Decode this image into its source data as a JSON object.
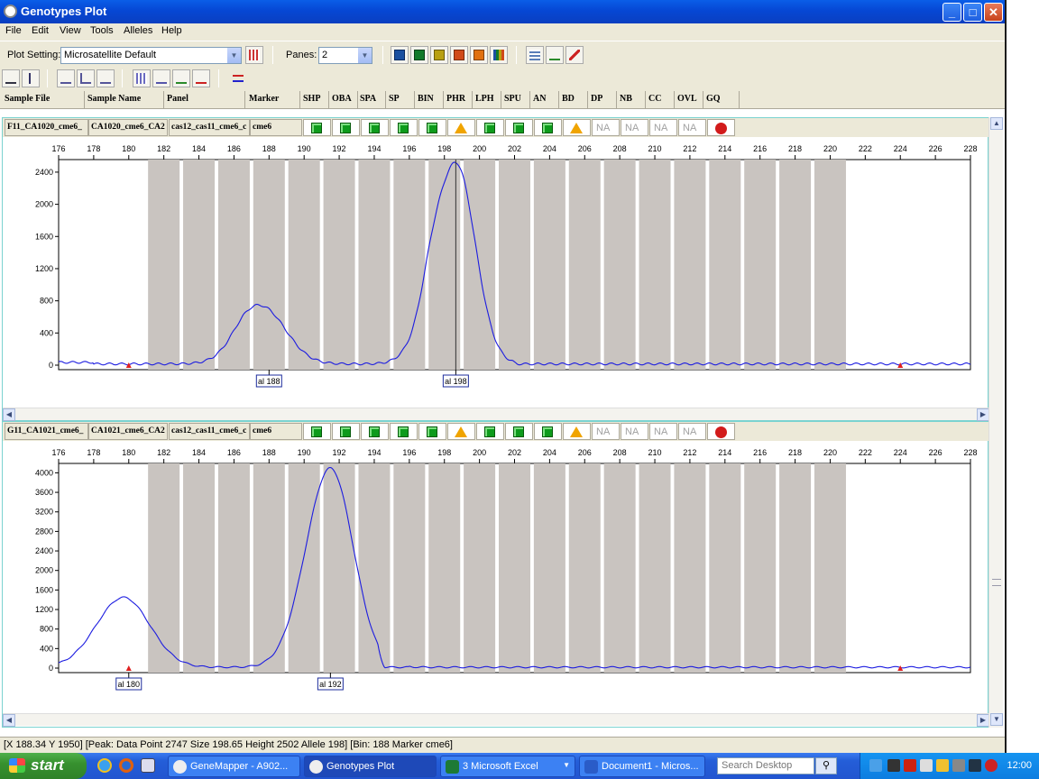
{
  "window": {
    "title": "Genotypes Plot"
  },
  "menu": [
    "File",
    "Edit",
    "View",
    "Tools",
    "Alleles",
    "Help"
  ],
  "toolbar": {
    "plot_setting_label": "Plot Setting:",
    "plot_setting_value": "Microsatellite Default",
    "panes_label": "Panes:",
    "panes_value": "2"
  },
  "columns": [
    "Sample File",
    "Sample Name",
    "Panel",
    "Marker",
    "SHP",
    "OBA",
    "SPA",
    "SP",
    "BIN",
    "PHR",
    "LPH",
    "SPU",
    "AN",
    "BD",
    "DP",
    "NB",
    "CC",
    "OVL",
    "GQ"
  ],
  "x_ticks": [
    176,
    178,
    180,
    182,
    184,
    186,
    188,
    190,
    192,
    194,
    196,
    198,
    200,
    202,
    204,
    206,
    208,
    210,
    212,
    214,
    216,
    218,
    220,
    222,
    224,
    226,
    228
  ],
  "flag_types": [
    "green",
    "green",
    "green",
    "green",
    "green",
    "yellow",
    "green",
    "green",
    "green",
    "yellow",
    "na",
    "na",
    "na",
    "na",
    "red"
  ],
  "na_label": "NA",
  "panes": [
    {
      "sample_file": "F11_CA1020_cme6_",
      "sample_name": "CA1020_cme6_CA2",
      "panel": "cas12_cas11_cme6_c",
      "marker": "cme6",
      "y_ticks": [
        0,
        400,
        800,
        1200,
        1600,
        2000,
        2400
      ],
      "y_max": 2500,
      "alleles": [
        {
          "label": "al 188",
          "x": 188
        },
        {
          "label": "al 198",
          "x": 198.65
        }
      ]
    },
    {
      "sample_file": "G11_CA1021_cme6_",
      "sample_name": "CA1021_cme6_CA2",
      "panel": "cas12_cas11_cme6_c",
      "marker": "cme6",
      "y_ticks": [
        0,
        400,
        800,
        1200,
        1600,
        2000,
        2400,
        2800,
        3200,
        3600,
        4000
      ],
      "y_max": 4100,
      "alleles": [
        {
          "label": "al 180",
          "x": 180
        },
        {
          "label": "al 192",
          "x": 191.5
        }
      ]
    }
  ],
  "status": "[X 188.34  Y 1950]  [Peak: Data Point 2747  Size 198.65  Height 2502  Allele 198]  [Bin: 188 Marker cme6]",
  "taskbar": {
    "start": "start",
    "tasks": [
      "GeneMapper - A902...",
      "Genotypes Plot",
      "3 Microsoft Excel",
      "Document1 - Micros..."
    ],
    "search_placeholder": "Search Desktop",
    "clock": "12:00"
  }
}
